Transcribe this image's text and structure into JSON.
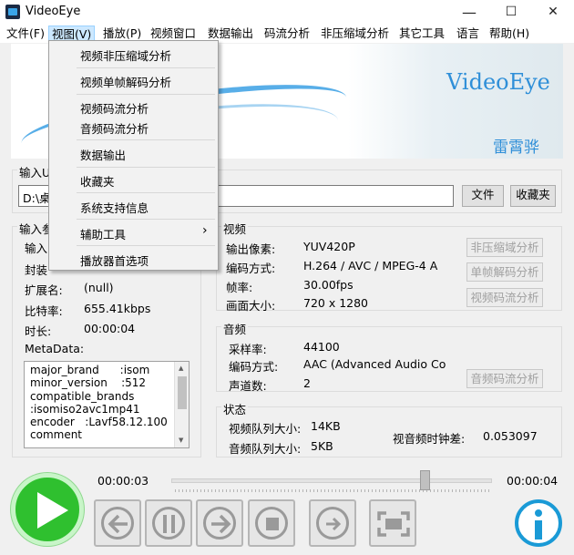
{
  "window": {
    "title": "VideoEye",
    "minimize": "—",
    "maximize": "☐",
    "close": "✕"
  },
  "menu": [
    "文件(F)",
    "视图(V)",
    "播放(P)",
    "视频窗口",
    "数据输出",
    "码流分析",
    "非压缩域分析",
    "其它工具",
    "语言",
    "帮助(H)"
  ],
  "banner": {
    "brand": "VideoEye",
    "author": "雷霄骅"
  },
  "input_url": {
    "label": "输入U",
    "value": "D:\\桌",
    "file_button": "文件",
    "favorite_button": "收藏夹"
  },
  "input_params": {
    "label": "输入参",
    "rows": [
      {
        "label": "输入",
        "value": ""
      },
      {
        "label": "封装",
        "value": ""
      },
      {
        "label": "扩展名:",
        "value": "(null)"
      },
      {
        "label": "比特率:",
        "value": "655.41kbps"
      },
      {
        "label": "时长:",
        "value": "00:00:04"
      }
    ],
    "metadata_label": "MetaData:",
    "metadata_text": "major_brand      :isom\nminor_version    :512\ncompatible_brands\n:isomiso2avc1mp41\nencoder   :Lavf58.12.100\ncomment"
  },
  "video": {
    "label": "视频",
    "rows": [
      {
        "label": "输出像素:",
        "value": "YUV420P"
      },
      {
        "label": "编码方式:",
        "value": "H.264 / AVC / MPEG-4 A"
      },
      {
        "label": "帧率:",
        "value": "30.00fps"
      },
      {
        "label": "画面大小:",
        "value": "720 x 1280"
      }
    ],
    "buttons": [
      "非压缩域分析",
      "单帧解码分析",
      "视频码流分析"
    ]
  },
  "audio": {
    "label": "音频",
    "rows": [
      {
        "label": "采样率:",
        "value": "44100"
      },
      {
        "label": "编码方式:",
        "value": "AAC (Advanced Audio Co"
      },
      {
        "label": "声道数:",
        "value": "2"
      }
    ],
    "button": "音频码流分析"
  },
  "status": {
    "label": "状态",
    "video_queue_label": "视频队列大小:",
    "video_queue_value": "14KB",
    "audio_queue_label": "音频队列大小:",
    "audio_queue_value": "5KB",
    "av_diff_label": "视音频时钟差:",
    "av_diff_value": "0.053097"
  },
  "playback": {
    "current_time": "00:00:03",
    "total_time": "00:00:04",
    "progress": 0.79
  },
  "view_menu": {
    "items": [
      "视频非压缩域分析",
      "视频单帧解码分析",
      "视频码流分析",
      "音频码流分析",
      "数据输出",
      "收藏夹",
      "系统支持信息",
      "辅助工具",
      "播放器首选项"
    ],
    "submenu_arrow": "›"
  },
  "icons": {
    "play": "play-icon",
    "back": "back-icon",
    "pause": "pause-icon",
    "forward": "forward-icon",
    "stop": "stop-icon",
    "next_frame": "next-frame-icon",
    "fullscreen": "fullscreen-icon",
    "info": "info-icon"
  },
  "colors": {
    "play": "#2fc02f",
    "info": "#1a9ad6",
    "accent": "#2f8fd8"
  }
}
